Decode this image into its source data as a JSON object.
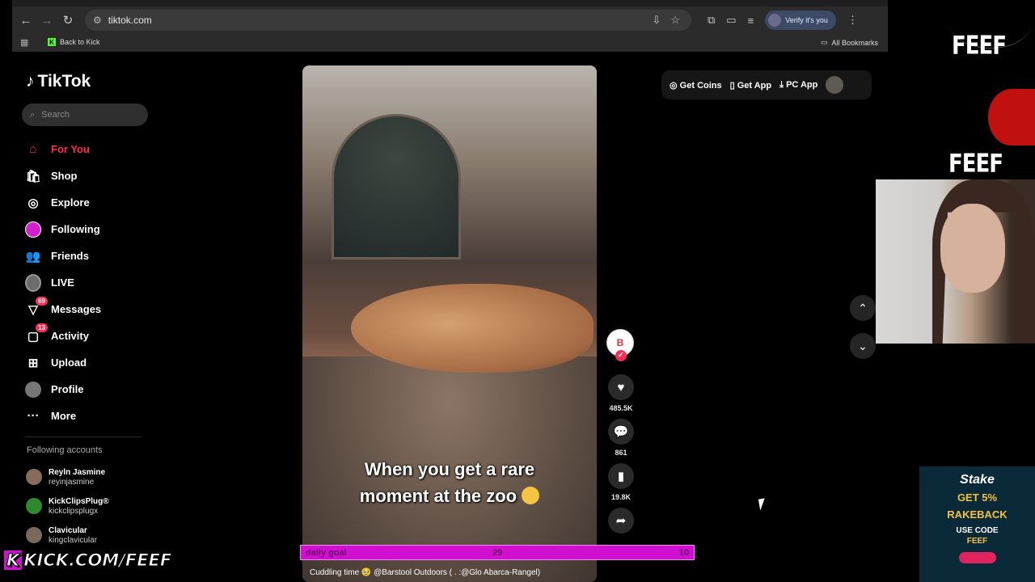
{
  "browser": {
    "url": "tiktok.com",
    "verify_label": "Verify it's you",
    "bookmarks": {
      "kick": "Back to Kick",
      "all": "All Bookmarks"
    }
  },
  "tiktok": {
    "logo": "TikTok",
    "search_placeholder": "Search",
    "nav": [
      {
        "label": "For You",
        "icon": "home-icon"
      },
      {
        "label": "Shop",
        "icon": "shop-icon"
      },
      {
        "label": "Explore",
        "icon": "compass-icon"
      },
      {
        "label": "Following",
        "icon": "following-avatar"
      },
      {
        "label": "Friends",
        "icon": "friends-icon"
      },
      {
        "label": "LIVE",
        "icon": "live-avatar"
      },
      {
        "label": "Messages",
        "icon": "messages-icon",
        "badge": "69"
      },
      {
        "label": "Activity",
        "icon": "activity-icon",
        "badge": "13"
      },
      {
        "label": "Upload",
        "icon": "upload-icon"
      },
      {
        "label": "Profile",
        "icon": "profile-avatar"
      },
      {
        "label": "More",
        "icon": "more-icon"
      }
    ],
    "following_title": "Following accounts",
    "accounts": [
      {
        "name": "Reyln Jasmine",
        "handle": "reyinjasmine"
      },
      {
        "name": "KickClipsPlug®",
        "handle": "kickclipsplugx"
      },
      {
        "name": "Clavicular",
        "handle": "kingclavicular"
      }
    ],
    "topbar": {
      "coins": "Get Coins",
      "app": "Get App",
      "pc": "PC App"
    },
    "video": {
      "caption_line1": "When you get a rare",
      "caption_line2": "moment at the zoo",
      "description": "Cuddling time 🥹 @Barstool Outdoors ( . :@Glo Abarca-Rangel)"
    },
    "actions": {
      "likes": "485.5K",
      "comments": "861",
      "saves": "19.8K"
    }
  },
  "stream": {
    "goal_label": "daily goal",
    "goal_current": "29",
    "goal_target": "10",
    "kick_url_k": "K",
    "kick_url": "KICK.COM/FEEF",
    "feef_tag": "FEEF",
    "stake": {
      "brand": "Stake",
      "line1": "GET 5%",
      "line2": "RAKEBACK",
      "use": "USE CODE",
      "code": "FEEF"
    }
  }
}
